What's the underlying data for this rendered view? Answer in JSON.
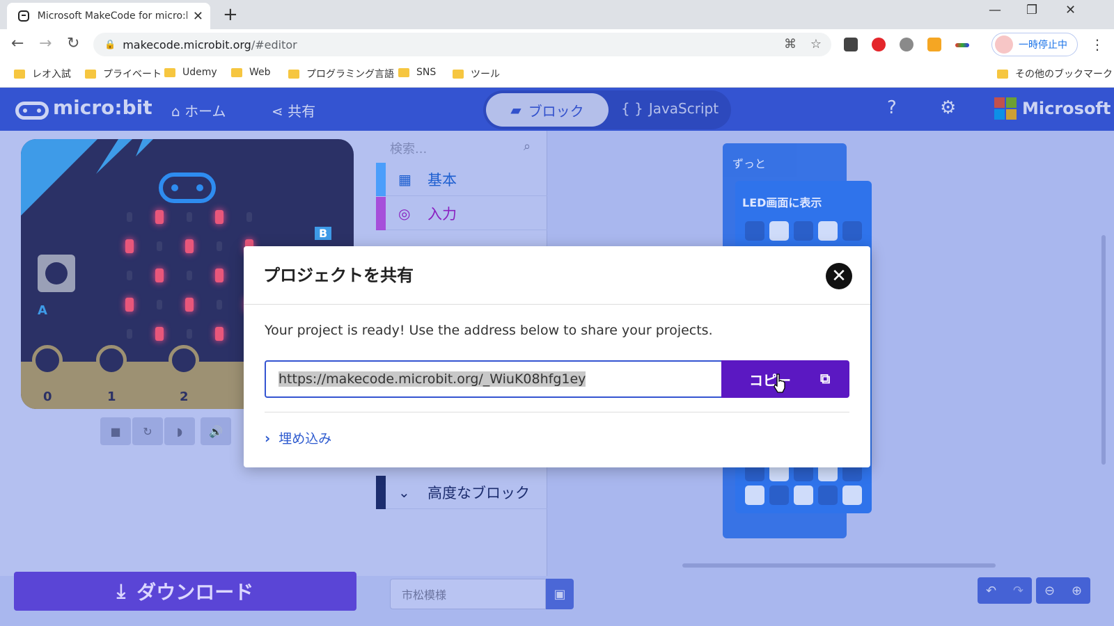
{
  "browser": {
    "tab_title": "Microsoft MakeCode for micro:bit",
    "new_tab": "+",
    "url_host": "makecode.microbit.org",
    "url_path": "/#editor",
    "profile_label": "一時停止中",
    "bookmarks": [
      {
        "label": "レオ入試"
      },
      {
        "label": "プライベート"
      },
      {
        "label": "Udemy"
      },
      {
        "label": "Web"
      },
      {
        "label": "プログラミング言語"
      },
      {
        "label": "SNS"
      },
      {
        "label": "ツール"
      },
      {
        "label": "その他のブックマーク"
      }
    ]
  },
  "header": {
    "logo": "micro:bit",
    "home": "ホーム",
    "share": "共有",
    "mode_blocks": "ブロック",
    "mode_js": "JavaScript",
    "brand": "Microsoft",
    "icons": [
      "help-icon",
      "gear-icon"
    ]
  },
  "simulator": {
    "button_b": "B",
    "button_a": "A",
    "pins": [
      "0",
      "1",
      "2"
    ]
  },
  "toolbox": {
    "search_placeholder": "検索...",
    "categories": [
      {
        "label": "基本",
        "color": "#1e90ff",
        "icon": "grid-icon"
      },
      {
        "label": "入力",
        "color": "#d400d4",
        "icon": "target-icon"
      },
      {
        "label": "高度なブロック",
        "color": "#3c3c3c",
        "icon": "chevron-down-icon"
      }
    ]
  },
  "workspace": {
    "forever_label": "ずっと",
    "show_leds_label": "LED画面に表示",
    "block_color": "#1e90ff"
  },
  "bottom": {
    "download_label": "ダウンロード",
    "project_name": "市松模様"
  },
  "modal": {
    "title": "プロジェクトを共有",
    "message": "Your project is ready! Use the address below to share your projects.",
    "share_url": "https://makecode.microbit.org/_WiuK08hfg1ey",
    "copy_label": "コピー",
    "embed_label": "埋め込み",
    "copy_color": "#5b18c2"
  }
}
